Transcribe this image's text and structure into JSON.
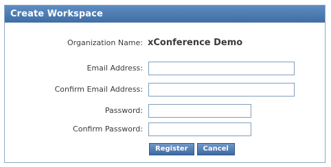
{
  "dialog": {
    "title": "Create Workspace"
  },
  "form": {
    "organization": {
      "label": "Organization Name:",
      "value": "xConference Demo"
    },
    "email": {
      "label": "Email Address:",
      "value": ""
    },
    "confirm_email": {
      "label": "Confirm Email Address:",
      "value": ""
    },
    "password": {
      "label": "Password:",
      "value": ""
    },
    "confirm_password": {
      "label": "Confirm Password:",
      "value": ""
    }
  },
  "buttons": {
    "register": "Register",
    "cancel": "Cancel"
  },
  "colors": {
    "title_bar": "#4a7bb4",
    "button": "#4e78ad",
    "border": "#8fa8c4"
  }
}
